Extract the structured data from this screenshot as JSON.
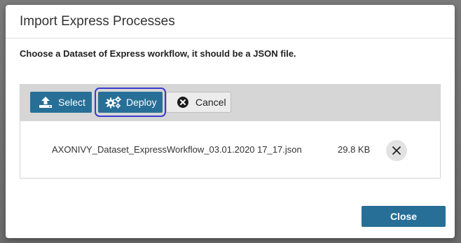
{
  "dialog": {
    "title": "Import Express Processes",
    "instructions": "Choose a Dataset of Express workflow, it should be a JSON file."
  },
  "toolbar": {
    "select_label": "Select",
    "deploy_label": "Deploy",
    "cancel_label": "Cancel"
  },
  "file": {
    "name": "AXONIVY_Dataset_ExpressWorkflow_03.01.2020 17_17.json",
    "size": "29.8 KB"
  },
  "footer": {
    "close_label": "Close"
  },
  "colors": {
    "primary": "#276f97",
    "focus_ring": "#3b3bd1"
  },
  "icons": {
    "select": "upload-icon",
    "deploy": "gears-icon",
    "cancel": "close-circle-icon",
    "remove": "close-icon"
  }
}
